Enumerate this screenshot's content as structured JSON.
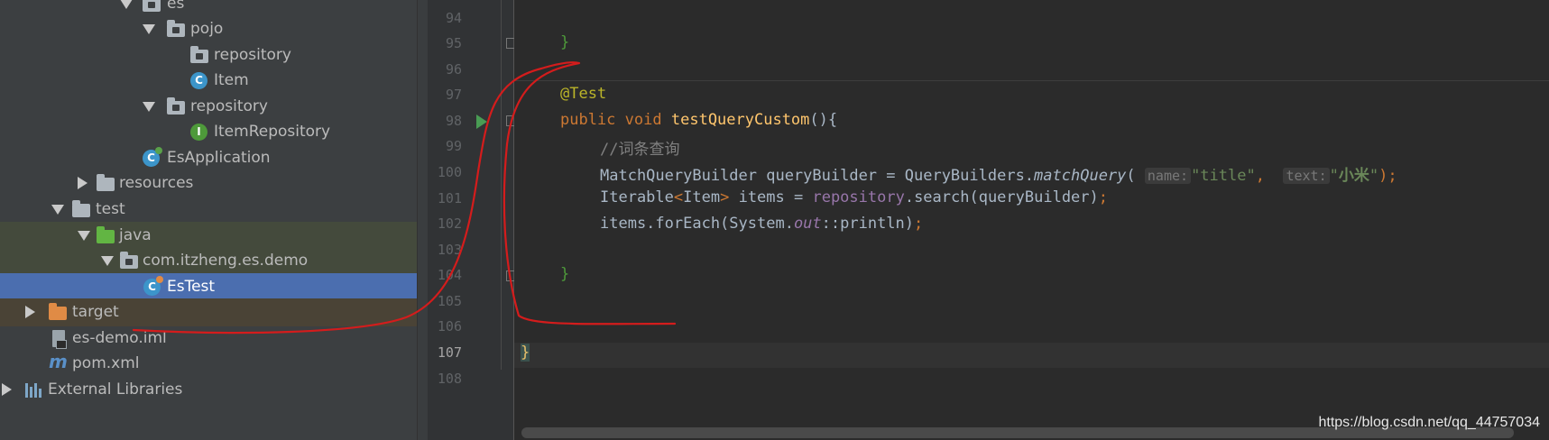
{
  "tree": {
    "items": [
      {
        "label": "es",
        "icon": "package-folder-icon"
      },
      {
        "label": "pojo",
        "icon": "package-folder-icon"
      },
      {
        "label": "repository",
        "icon": "package-folder-icon"
      },
      {
        "label": "Item",
        "icon": "class-icon"
      },
      {
        "label": "repository",
        "icon": "package-folder-icon"
      },
      {
        "label": "ItemRepository",
        "icon": "interface-icon"
      },
      {
        "label": "EsApplication",
        "icon": "spring-app-class-icon"
      },
      {
        "label": "resources",
        "icon": "resources-folder-icon"
      },
      {
        "label": "test",
        "icon": "folder-icon"
      },
      {
        "label": "java",
        "icon": "test-sources-folder-icon"
      },
      {
        "label": "com.itzheng.es.demo",
        "icon": "package-folder-icon"
      },
      {
        "label": "EsTest",
        "icon": "test-class-icon"
      },
      {
        "label": "target",
        "icon": "excluded-folder-icon"
      },
      {
        "label": "es-demo.iml",
        "icon": "iml-file-icon"
      },
      {
        "label": "pom.xml",
        "icon": "maven-icon"
      },
      {
        "label": "External Libraries",
        "icon": "libraries-icon"
      }
    ],
    "class_badge": "C",
    "interface_badge": "I"
  },
  "editor": {
    "line_numbers": [
      "94",
      "95",
      "96",
      "97",
      "98",
      "99",
      "100",
      "101",
      "102",
      "103",
      "104",
      "105",
      "106",
      "107",
      "108"
    ],
    "current_line": "107",
    "code": {
      "close_brace": "}",
      "annotation": "@Test",
      "kw_public": "public",
      "kw_void": "void",
      "method_name": "testQueryCustom",
      "method_open": "(){",
      "comment": "//词条查询",
      "l100_type": "MatchQueryBuilder queryBuilder = QueryBuilders.",
      "l100_method": "matchQuery",
      "l100_paren": "(",
      "hint_name": "name:",
      "str_title": "\"title\"",
      "comma": ",",
      "hint_text": "text:",
      "str_q_open": "\"",
      "str_xiaomi": "小米",
      "str_q_close": "\"",
      "l100_end": ");",
      "l101_iterable": "Iterable",
      "l101_lt": "<",
      "l101_item": "Item",
      "l101_gt": ">",
      "l101_mid": " items = ",
      "l101_repo": "repository",
      "l101_call": ".search(queryBuilder)",
      "semicolon": ";",
      "l102_start": "items.forEach(System.",
      "l102_out": "out",
      "l102_end": "::println)",
      "class_close": "}"
    }
  },
  "watermark": "https://blog.csdn.net/qq_44757034",
  "colors": {
    "tree_bg": "#3c3f41",
    "selection": "#4b6eaf",
    "editor_bg": "#2b2b2b",
    "annotation_stroke": "#d41c1c"
  }
}
